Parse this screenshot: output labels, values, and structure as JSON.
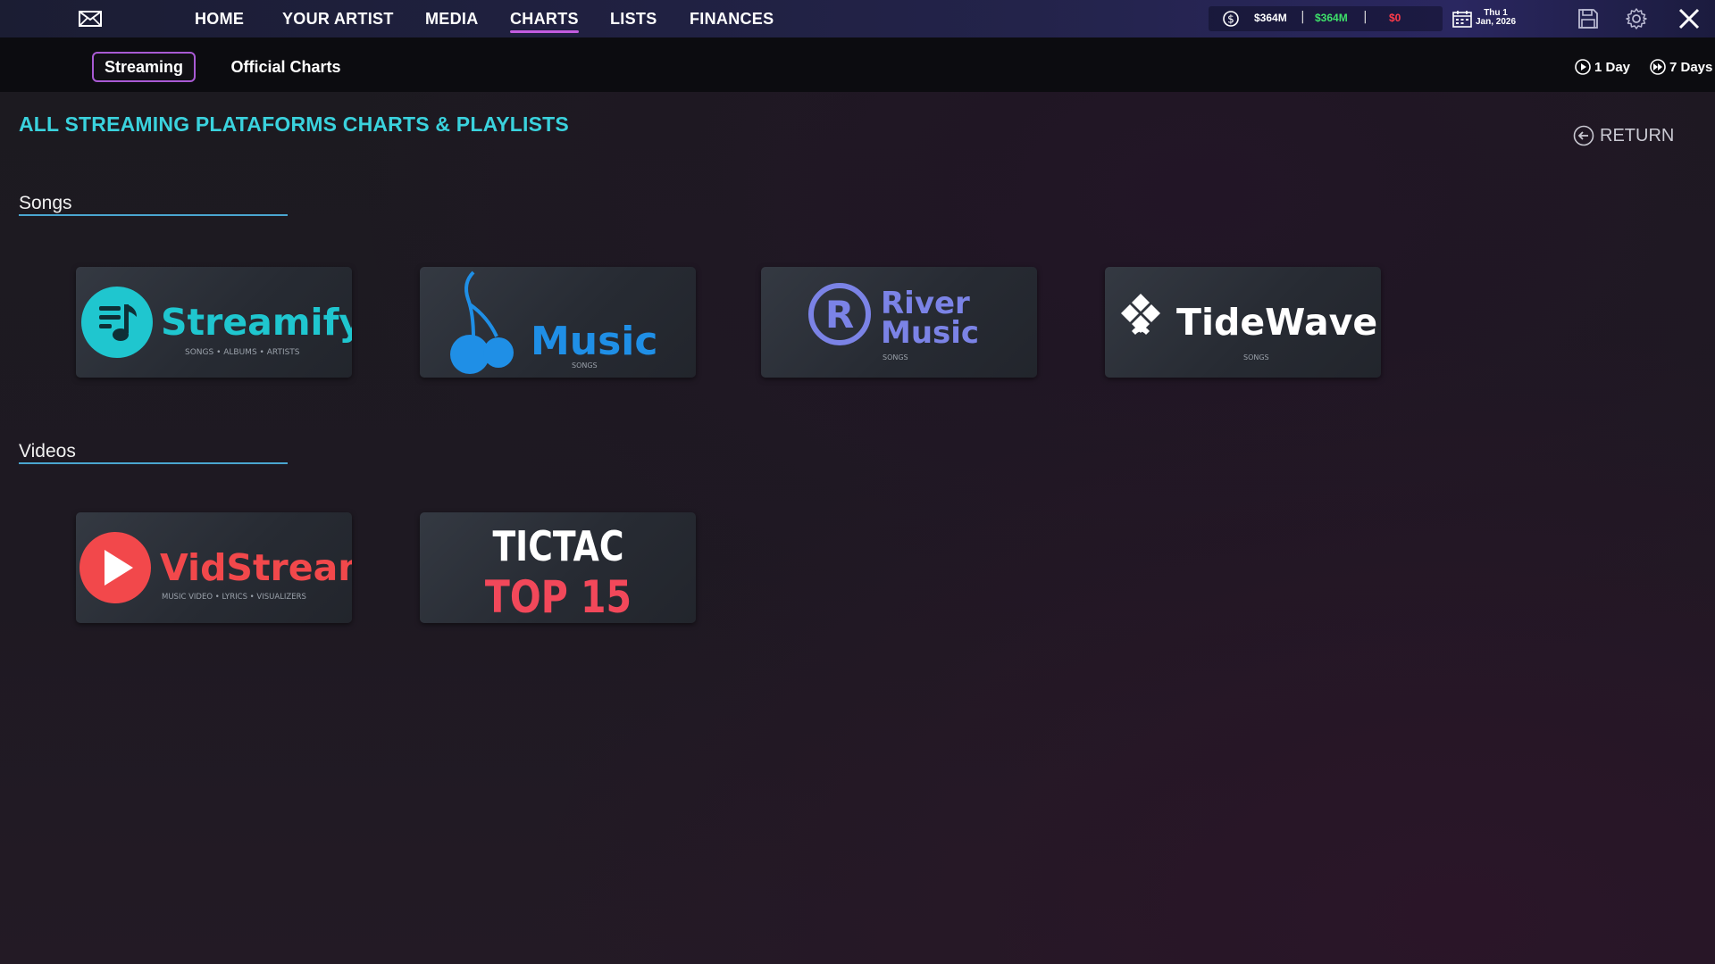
{
  "topbar": {
    "nav": [
      {
        "label": "HOME",
        "active": false
      },
      {
        "label": "YOUR ARTIST",
        "active": false
      },
      {
        "label": "MEDIA",
        "active": false
      },
      {
        "label": "CHARTS",
        "active": true
      },
      {
        "label": "LISTS",
        "active": false
      },
      {
        "label": "FINANCES",
        "active": false
      }
    ],
    "money": {
      "total": "$364M",
      "income": "$364M",
      "expense": "$0",
      "separator": "|"
    },
    "date": {
      "day": "Thu 1",
      "month_year": "Jan, 2026"
    },
    "icons": [
      "mail-icon",
      "dollar-icon",
      "calendar-icon",
      "save-icon",
      "gear-icon",
      "close-icon"
    ]
  },
  "subbar": {
    "tabs": [
      {
        "label": "Streaming",
        "active": true
      },
      {
        "label": "Official Charts",
        "active": false
      }
    ],
    "speed": [
      {
        "label": "1 Day",
        "icon": "play-icon"
      },
      {
        "label": "7 Days",
        "icon": "fast-forward-icon"
      }
    ]
  },
  "main": {
    "title": "ALL STREAMING PLATAFORMS CHARTS & PLAYLISTS",
    "return_label": "RETURN",
    "sections": [
      {
        "label": "Songs",
        "cards": [
          {
            "name": "Streamify",
            "subtitle": "SONGS • ALBUMS • ARTISTS",
            "color": "#1fc6cf"
          },
          {
            "name": "Music",
            "subtitle": "SONGS",
            "color": "#1f8fe6"
          },
          {
            "name_line1": "River",
            "name_line2": "Music",
            "subtitle": "SONGS",
            "color": "#7b83e6"
          },
          {
            "name": "TideWave",
            "subtitle": "SONGS",
            "color": "#ffffff"
          }
        ]
      },
      {
        "label": "Videos",
        "cards": [
          {
            "name": "VidStream",
            "subtitle": "MUSIC VIDEO • LYRICS • VISUALIZERS",
            "color": "#f2484b"
          },
          {
            "name_line1": "TICTAC",
            "name_line2": "TOP 15",
            "color": "#f2485a"
          }
        ]
      }
    ]
  }
}
